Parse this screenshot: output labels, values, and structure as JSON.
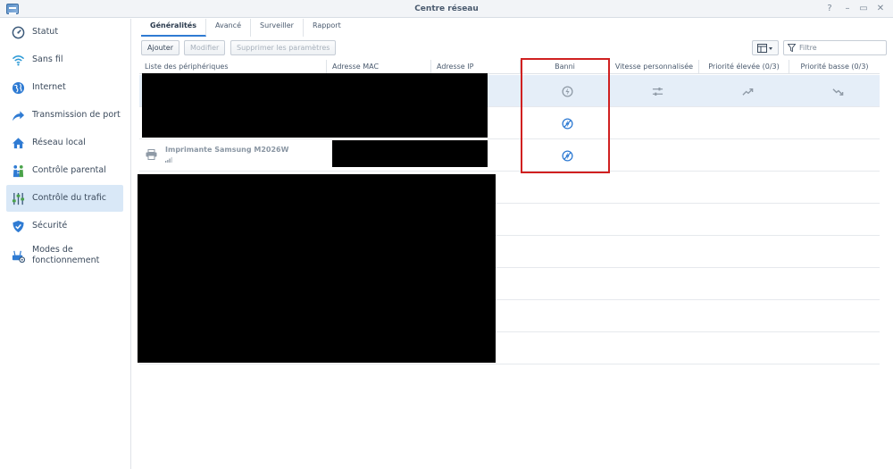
{
  "window": {
    "title": "Centre réseau"
  },
  "sidebar": {
    "items": [
      {
        "label": "Statut"
      },
      {
        "label": "Sans fil"
      },
      {
        "label": "Internet"
      },
      {
        "label": "Transmission de port"
      },
      {
        "label": "Réseau local"
      },
      {
        "label": "Contrôle parental"
      },
      {
        "label": "Contrôle du trafic"
      },
      {
        "label": "Sécurité"
      },
      {
        "label": "Modes de fonctionnement"
      }
    ],
    "active": "Contrôle du trafic"
  },
  "tabs": [
    "Généralités",
    "Avancé",
    "Surveiller",
    "Rapport"
  ],
  "toolbar": {
    "add_label": "Ajouter",
    "edit_label": "Modifier",
    "delete_label": "Supprimer les paramètres",
    "filter_placeholder": "Filtre"
  },
  "table": {
    "columns": [
      "Liste des périphériques",
      "Adresse MAC",
      "Adresse IP",
      "Banni",
      "Vitesse personnalisée",
      "Priorité élevée (0/3)",
      "Priorité basse (0/3)"
    ],
    "rows": [
      {
        "device": "",
        "selected": true
      },
      {
        "device": ""
      },
      {
        "device": "Imprimante Samsung M2026W"
      }
    ]
  },
  "colors": {
    "accent": "#2f7bd3",
    "selected_row": "#e5eef8",
    "highlight": "#d02020"
  }
}
